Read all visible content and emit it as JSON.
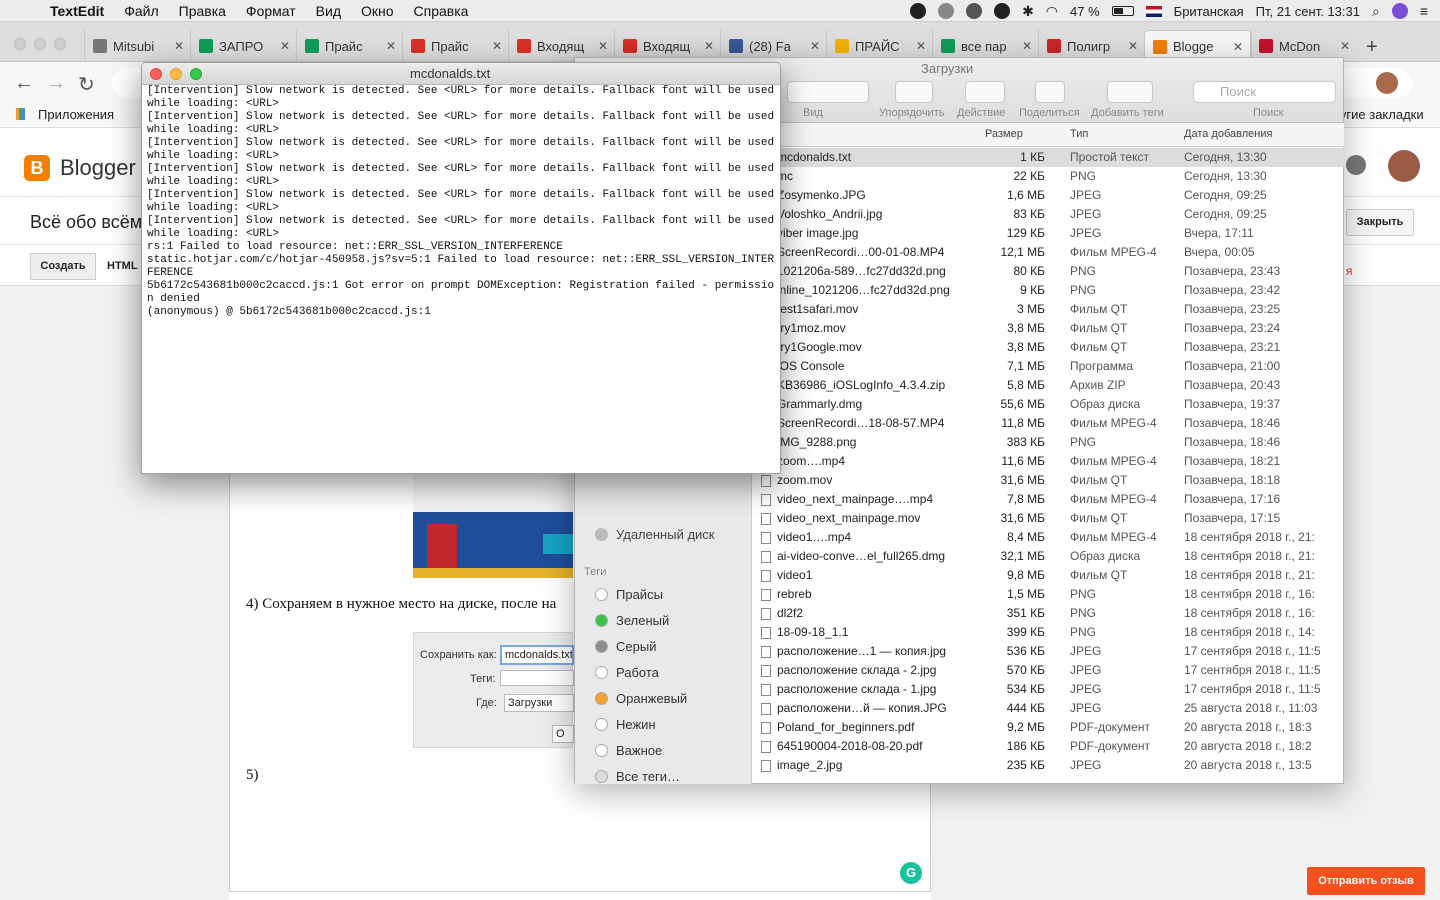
{
  "menubar": {
    "app": "TextEdit",
    "items": [
      "Файл",
      "Правка",
      "Формат",
      "Вид",
      "Окно",
      "Справка"
    ],
    "battery": "47 %",
    "keyboard": "Британская",
    "clock": "Пт, 21 сент.  13:31"
  },
  "browser": {
    "tabs": [
      {
        "label": "Mitsubi",
        "icon": "page-icon"
      },
      {
        "label": "ЗАПРО",
        "icon": "sheets-icon"
      },
      {
        "label": "Прайс",
        "icon": "sheets-icon"
      },
      {
        "label": "Прайс",
        "icon": "gmail-icon"
      },
      {
        "label": "Входящ",
        "icon": "gmail-icon"
      },
      {
        "label": "Входящ",
        "icon": "gmail-icon"
      },
      {
        "label": "(28) Fa",
        "icon": "facebook-icon"
      },
      {
        "label": "ПРАЙС",
        "icon": "drive-icon"
      },
      {
        "label": "все пар",
        "icon": "sheets-icon"
      },
      {
        "label": "Полигр",
        "icon": "k-icon"
      },
      {
        "label": "Blogge",
        "icon": "blogger-icon",
        "active": true
      },
      {
        "label": "McDon",
        "icon": "mcdonalds-icon"
      }
    ],
    "bookmarks": {
      "apps": "Приложения",
      "other": "Другие закладки"
    }
  },
  "blogger": {
    "brand": "Blogger",
    "blog_title": "Всё обо всём",
    "create": "Создать",
    "html": "HTML",
    "close": "Закрыть",
    "step4": "4) Сохраняем в нужное место на диске, после на",
    "step5": "5)",
    "save_as_label": "Сохранить как:",
    "save_as_value": "mcdonalds.txt",
    "tags_label": "Теги:",
    "where_label": "Где:",
    "where_value": "Загрузки",
    "ok": "О",
    "feedback": "Отправить отзыв",
    "red_fragment": "я"
  },
  "finder": {
    "title": "Загрузки",
    "toolbar": {
      "view": "Вид",
      "arrange": "Упорядочить",
      "action": "Действие",
      "share": "Поделиться",
      "tags": "Добавить теги",
      "search_label": "Поиск",
      "search_placeholder": "Поиск"
    },
    "sidebar": {
      "remote_disk": "Удаленный диск",
      "tags_header": "Теги",
      "tags": [
        {
          "label": "Прайсы",
          "color": "#ffffff"
        },
        {
          "label": "Зеленый",
          "color": "#3cc14a"
        },
        {
          "label": "Серый",
          "color": "#8e8e8e"
        },
        {
          "label": "Работа",
          "color": "#ffffff"
        },
        {
          "label": "Оранжевый",
          "color": "#f6a02c"
        },
        {
          "label": "Нежин",
          "color": "#ffffff"
        },
        {
          "label": "Важное",
          "color": "#ffffff"
        },
        {
          "label": "Все теги…",
          "color": "#dddddd"
        }
      ]
    },
    "columns": {
      "size": "Размер",
      "kind": "Тип",
      "date": "Дата добавления"
    },
    "files": [
      [
        "mcdonalds.txt",
        "1 КБ",
        "Простой текст",
        "Сегодня, 13:30"
      ],
      [
        "mc",
        "22 КБ",
        "PNG",
        "Сегодня, 13:30"
      ],
      [
        "Zosymenko.JPG",
        "1,6 МБ",
        "JPEG",
        "Сегодня, 09:25"
      ],
      [
        "Voloshko_Andrii.jpg",
        "83 КБ",
        "JPEG",
        "Сегодня, 09:25"
      ],
      [
        "viber image.jpg",
        "129 КБ",
        "JPEG",
        "Вчера, 17:11"
      ],
      [
        "ScreenRecordi…00-01-08.MP4",
        "12,1 МБ",
        "Фильм MPEG-4",
        "Вчера, 00:05"
      ],
      [
        "1021206a-589…fc27dd32d.png",
        "80 КБ",
        "PNG",
        "Позавчера, 23:43"
      ],
      [
        "inline_1021206…fc27dd32d.png",
        "9 КБ",
        "PNG",
        "Позавчера, 23:42"
      ],
      [
        "test1safari.mov",
        "3 МБ",
        "Фильм QT",
        "Позавчера, 23:25"
      ],
      [
        "try1moz.mov",
        "3,8 МБ",
        "Фильм QT",
        "Позавчера, 23:24"
      ],
      [
        "try1Google.mov",
        "3,8 МБ",
        "Фильм QT",
        "Позавчера, 23:21"
      ],
      [
        "iOS Console",
        "7,1 МБ",
        "Программа",
        "Позавчера, 21:00"
      ],
      [
        "KB36986_iOSLogInfo_4.3.4.zip",
        "5,8 МБ",
        "Архив ZIP",
        "Позавчера, 20:43"
      ],
      [
        "Grammarly.dmg",
        "55,6 МБ",
        "Образ диска",
        "Позавчера, 19:37"
      ],
      [
        "ScreenRecordi…18-08-57.MP4",
        "11,8 МБ",
        "Фильм MPEG-4",
        "Позавчера, 18:46"
      ],
      [
        "IMG_9288.png",
        "383 КБ",
        "PNG",
        "Позавчера, 18:46"
      ],
      [
        "zoom….mp4",
        "11,6 МБ",
        "Фильм MPEG-4",
        "Позавчера, 18:21"
      ],
      [
        "zoom.mov",
        "31,6 МБ",
        "Фильм QT",
        "Позавчера, 18:18"
      ],
      [
        "video_next_mainpage….mp4",
        "7,8 МБ",
        "Фильм MPEG-4",
        "Позавчера, 17:16"
      ],
      [
        "video_next_mainpage.mov",
        "31,6 МБ",
        "Фильм QT",
        "Позавчера, 17:15"
      ],
      [
        "video1….mp4",
        "8,4 МБ",
        "Фильм MPEG-4",
        "18 сентября 2018 г., 21:"
      ],
      [
        "ai-video-conve…el_full265.dmg",
        "32,1 МБ",
        "Образ диска",
        "18 сентября 2018 г., 21:"
      ],
      [
        "video1",
        "9,8 МБ",
        "Фильм QT",
        "18 сентября 2018 г., 21:"
      ],
      [
        "rebreb",
        "1,5 МБ",
        "PNG",
        "18 сентября 2018 г., 16:"
      ],
      [
        "dl2f2",
        "351 КБ",
        "PNG",
        "18 сентября 2018 г., 16:"
      ],
      [
        "18-09-18_1.1",
        "399 КБ",
        "PNG",
        "18 сентября 2018 г., 14:"
      ],
      [
        "расположение…1 — копия.jpg",
        "536 КБ",
        "JPEG",
        "17 сентября 2018 г., 11:5"
      ],
      [
        "расположение склада - 2.jpg",
        "570 КБ",
        "JPEG",
        "17 сентября 2018 г., 11:5"
      ],
      [
        "расположение склада - 1.jpg",
        "534 КБ",
        "JPEG",
        "17 сентября 2018 г., 11:5"
      ],
      [
        "расположени…й — копия.JPG",
        "444 КБ",
        "JPEG",
        "25 августа 2018 г., 11:03"
      ],
      [
        "Poland_for_beginners.pdf",
        "9,2 МБ",
        "PDF-документ",
        "20 августа 2018 г., 18:3"
      ],
      [
        "645190004-2018-08-20.pdf",
        "186 КБ",
        "PDF-документ",
        "20 августа 2018 г., 18:2"
      ],
      [
        "image_2.jpg",
        "235 КБ",
        "JPEG",
        "20 августа 2018 г., 13:5"
      ]
    ]
  },
  "textedit": {
    "title": "mcdonalds.txt",
    "content": "[Intervention] Slow network is detected. See <URL> for more details. Fallback font will be used while loading: <URL>\n[Intervention] Slow network is detected. See <URL> for more details. Fallback font will be used while loading: <URL>\n[Intervention] Slow network is detected. See <URL> for more details. Fallback font will be used while loading: <URL>\n[Intervention] Slow network is detected. See <URL> for more details. Fallback font will be used while loading: <URL>\n[Intervention] Slow network is detected. See <URL> for more details. Fallback font will be used while loading: <URL>\n[Intervention] Slow network is detected. See <URL> for more details. Fallback font will be used while loading: <URL>\nrs:1 Failed to load resource: net::ERR_SSL_VERSION_INTERFERENCE\nstatic.hotjar.com/c/hotjar-450958.js?sv=5:1 Failed to load resource: net::ERR_SSL_VERSION_INTERFERENCE\n5b6172c543681b000c2caccd.js:1 Got error on prompt DOMException: Registration failed - permission denied\n(anonymous) @ 5b6172c543681b000c2caccd.js:1"
  }
}
